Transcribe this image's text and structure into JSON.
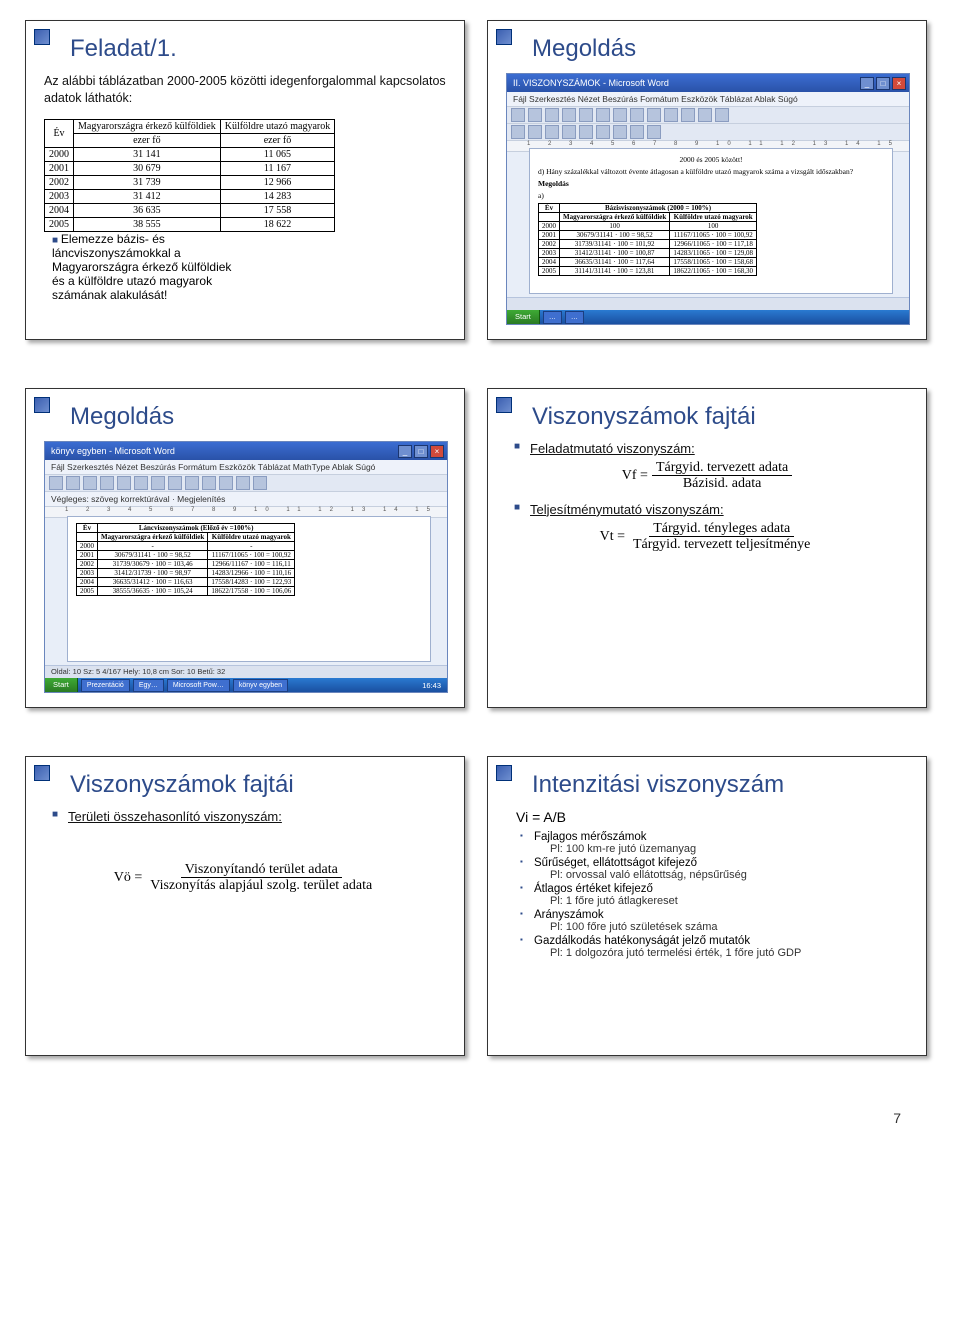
{
  "slide1": {
    "title": "Feladat/1.",
    "intro": "Az alábbi táblázatban 2000-2005 közötti idegenforgalommal kapcsolatos adatok láthatók:",
    "table": {
      "headers": [
        "Év",
        "Magyarországra érkező külföldiek",
        "Külföldre utazó magyarok"
      ],
      "unit_row": [
        "",
        "ezer fő",
        "ezer fő"
      ],
      "rows": [
        [
          "2000",
          "31 141",
          "11 065"
        ],
        [
          "2001",
          "30 679",
          "11 167"
        ],
        [
          "2002",
          "31 739",
          "12 966"
        ],
        [
          "2003",
          "31 412",
          "14 283"
        ],
        [
          "2004",
          "36 635",
          "17 558"
        ],
        [
          "2005",
          "38 555",
          "18 622"
        ]
      ]
    },
    "task_text": "Elemezze bázis- és láncviszonyszámokkal a Magyarországra érkező külföldiek és a külföldre utazó magyarok számának alakulását!"
  },
  "slide2": {
    "title": "Megoldás",
    "ss_title": "II. VISZONYSZÁMOK - Microsoft Word",
    "doc_header": "2000 és 2005 között!",
    "doc_question": "Hány százalékkal változott évente átlagosan a külföldre utazó magyarok száma a vizsgált időszakban?",
    "doc_section": "Megoldás",
    "inner_table_title": "Bázisviszonyszámok (2000 = 100%)",
    "inner_headers": [
      "Év",
      "Magyarországra érkező külföldiek",
      "Külföldre utazó magyarok"
    ],
    "inner_rows": [
      [
        "2000",
        "100",
        "100"
      ],
      [
        "2001",
        "30679/31141 · 100 = 98,52",
        "11167/11065 · 100 = 100,92"
      ],
      [
        "2002",
        "31739/31141 · 100 = 101,92",
        "12966/11065 · 100 = 117,18"
      ],
      [
        "2003",
        "31412/31141 · 100 = 100,87",
        "14283/11065 · 100 = 129,08"
      ],
      [
        "2004",
        "36635/31141 · 100 = 117,64",
        "17558/11065 · 100 = 158,68"
      ],
      [
        "2005",
        "31141/31141 · 100 = 123,81",
        "18622/11065 · 100 = 168,30"
      ]
    ]
  },
  "slide3": {
    "title": "Megoldás",
    "ss_title": "könyv egyben - Microsoft Word",
    "menu": "Fájl  Szerkesztés  Nézet  Beszúrás  Formátum  Eszközök  Táblázat  MathType  Ablak  Súgó",
    "mode_line": "Végleges: szöveg korrektúrával · Megjelenítés",
    "inner_table_title": "Láncviszonyszámok (Előző év =100%)",
    "inner_headers": [
      "Év",
      "Magyarországra érkező külföldiek",
      "Külföldre utazó magyarok"
    ],
    "inner_rows": [
      [
        "2000",
        "-",
        "-"
      ],
      [
        "2001",
        "30679/31141 · 100 = 98,52",
        "11167/11065 · 100 = 100,92"
      ],
      [
        "2002",
        "31739/30679 · 100 = 103,46",
        "12966/11167 · 100 = 116,11"
      ],
      [
        "2003",
        "31412/31739 · 100 = 98,97",
        "14283/12966 · 100 = 110,16"
      ],
      [
        "2004",
        "36635/31412 · 100 = 116,63",
        "17558/14283 · 100 = 122,93"
      ],
      [
        "2005",
        "38555/36635 · 100 = 105,24",
        "18622/17558 · 100 = 106,06"
      ]
    ],
    "status": "Oldal: 10   Sz: 5   4/167   Hely: 10,8 cm   Sor: 10   Betű: 32",
    "taskbar": {
      "start": "Start",
      "btn1": "Prezentáció",
      "btn2": "Egy…",
      "btn3": "Microsoft Pow…",
      "btn4": "könyv egyben",
      "clock": "16:43"
    }
  },
  "slide4": {
    "title": "Viszonyszámok fajtái",
    "bullets": [
      {
        "label": "Feladatmutató viszonyszám:",
        "formula": {
          "lhs": "Vf =",
          "num": "Tárgyid. tervezett adata",
          "den": "Bázisid. adata"
        }
      },
      {
        "label": "Teljesítménymutató viszonyszám:",
        "formula": {
          "lhs": "Vt =",
          "num": "Tárgyid. tényleges adata",
          "den": "Tárgyid. tervezett teljesítménye"
        }
      }
    ]
  },
  "slide5": {
    "title": "Viszonyszámok fajtái",
    "bullet_label": "Területi összehasonlító viszonyszám:",
    "formula": {
      "lhs": "Vö =",
      "num": "Viszonyítandó terület adata",
      "den": "Viszonyítás alapjául szolg. terület adata"
    }
  },
  "slide6": {
    "title": "Intenzitási viszonyszám",
    "lead": "Vi = A/B",
    "items": [
      {
        "main": "Fajlagos mérőszámok",
        "ex": "Pl: 100 km-re jutó üzemanyag"
      },
      {
        "main": "Sűrűséget, ellátottságot kifejező",
        "ex": "Pl: orvossal való ellátottság, népsűrűség"
      },
      {
        "main": "Átlagos értéket kifejező",
        "ex": "Pl: 1 főre jutó átlagkereset"
      },
      {
        "main": "Arányszámok",
        "ex": "Pl: 100 főre jutó születések száma"
      },
      {
        "main": "Gazdálkodás hatékonyságát jelző mutatók",
        "ex": "Pl: 1 dolgozóra jutó termelési érték, 1 főre jutó GDP"
      }
    ]
  },
  "page_number": "7"
}
